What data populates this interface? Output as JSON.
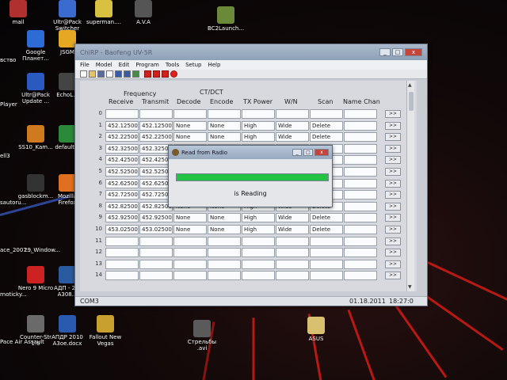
{
  "desktop": {
    "icons": [
      {
        "label": "mail",
        "color": "#b03030"
      },
      {
        "label": "Ultr@Pack Switcher",
        "color": "#3c6bd0"
      },
      {
        "label": "superman....",
        "color": "#d8c040"
      },
      {
        "label": "A.V.A",
        "color": "#555555"
      },
      {
        "label": "BC2Launch...",
        "color": "#6a8a3a"
      },
      {
        "label": "Google Планет...",
        "color": "#2d6bd6"
      },
      {
        "label": "JSGM",
        "color": "#e6a822"
      },
      {
        "label": "Ultr@Pack Update ...",
        "color": "#2a5ac0"
      },
      {
        "label": "EchoL...",
        "color": "#444444"
      },
      {
        "label": "SS10_Kam...",
        "color": "#d07a20"
      },
      {
        "label": "default...",
        "color": "#2a8a3a"
      },
      {
        "label": "gasblockm...",
        "color": "#333333"
      },
      {
        "label": "Mozilla Firefox",
        "color": "#e07020"
      },
      {
        "label": "Nero 9 Micro",
        "color": "#cc2222"
      },
      {
        "label": "АДП - 2... A308...",
        "color": "#2a5aa0"
      },
      {
        "label": "Counter-Str 1.6",
        "color": "#6a6a6a"
      },
      {
        "label": "АПДР 2010 A3oe.docx",
        "color": "#2a5ab0"
      },
      {
        "label": "Fallout New Vegas",
        "color": "#c8a030"
      },
      {
        "label": "Стрельбы .avi",
        "color": "#5a5a5a"
      },
      {
        "label": "ASUS",
        "color": "#d8c070"
      }
    ],
    "left_fragments": [
      "вство",
      "Player",
      "ell3",
      "sautoru...",
      "ace_2007...",
      "rnoticky...",
      "Pace Air Assault",
      "29_Window..."
    ]
  },
  "window": {
    "title": "ChiRP - Baofeng UV-5R",
    "controls": {
      "minimize": "_",
      "maximize": "□",
      "close": "x"
    },
    "menu": [
      "File",
      "Model",
      "Edit",
      "Program",
      "Tools",
      "Setup",
      "Help"
    ],
    "toolbar_icons": [
      "new-icon",
      "open-icon",
      "save-icon",
      "print-icon",
      "save-as-icon",
      "read-icon",
      "write-icon",
      "red-square-icon",
      "grid-icon",
      "grid-icon-2",
      "record-icon"
    ],
    "headers": {
      "group_frequency": "Frequency",
      "group_ctdct": "CT/DCT",
      "columns": [
        "Receive",
        "Transmit",
        "Decode",
        "Encode",
        "TX Power",
        "W/N",
        "Scan",
        "Name Chan"
      ]
    },
    "rows": [
      {
        "num": "0",
        "rx": "",
        "tx": "",
        "dec": "",
        "enc": "",
        "pwr": "",
        "wn": "",
        "scan": "",
        "name": ""
      },
      {
        "num": "1",
        "rx": "452.12500",
        "tx": "452.12500",
        "dec": "None",
        "enc": "None",
        "pwr": "High",
        "wn": "Wide",
        "scan": "Delete",
        "name": ""
      },
      {
        "num": "2",
        "rx": "452.22500",
        "tx": "452.22500",
        "dec": "None",
        "enc": "None",
        "pwr": "High",
        "wn": "Wide",
        "scan": "Delete",
        "name": ""
      },
      {
        "num": "3",
        "rx": "452.32500",
        "tx": "452.32500",
        "dec": "",
        "enc": "",
        "pwr": "",
        "wn": "",
        "scan": "",
        "name": ""
      },
      {
        "num": "4",
        "rx": "452.42500",
        "tx": "452.42500",
        "dec": "",
        "enc": "",
        "pwr": "",
        "wn": "",
        "scan": "",
        "name": ""
      },
      {
        "num": "5",
        "rx": "452.52500",
        "tx": "452.52500",
        "dec": "",
        "enc": "",
        "pwr": "",
        "wn": "",
        "scan": "",
        "name": ""
      },
      {
        "num": "6",
        "rx": "452.62500",
        "tx": "452.62500",
        "dec": "",
        "enc": "",
        "pwr": "",
        "wn": "",
        "scan": "",
        "name": ""
      },
      {
        "num": "7",
        "rx": "452.72500",
        "tx": "452.72500",
        "dec": "",
        "enc": "",
        "pwr": "",
        "wn": "",
        "scan": "",
        "name": ""
      },
      {
        "num": "8",
        "rx": "452.82500",
        "tx": "452.82500",
        "dec": "None",
        "enc": "None",
        "pwr": "High",
        "wn": "Wide",
        "scan": "Delete",
        "name": ""
      },
      {
        "num": "9",
        "rx": "452.92500",
        "tx": "452.92500",
        "dec": "None",
        "enc": "None",
        "pwr": "High",
        "wn": "Wide",
        "scan": "Delete",
        "name": ""
      },
      {
        "num": "10",
        "rx": "453.02500",
        "tx": "453.02500",
        "dec": "None",
        "enc": "None",
        "pwr": "High",
        "wn": "Wide",
        "scan": "Delete",
        "name": ""
      },
      {
        "num": "11",
        "rx": "",
        "tx": "",
        "dec": "",
        "enc": "",
        "pwr": "",
        "wn": "",
        "scan": "",
        "name": ""
      },
      {
        "num": "12",
        "rx": "",
        "tx": "",
        "dec": "",
        "enc": "",
        "pwr": "",
        "wn": "",
        "scan": "",
        "name": ""
      },
      {
        "num": "13",
        "rx": "",
        "tx": "",
        "dec": "",
        "enc": "",
        "pwr": "",
        "wn": "",
        "scan": "",
        "name": ""
      },
      {
        "num": "14",
        "rx": "",
        "tx": "",
        "dec": "",
        "enc": "",
        "pwr": "",
        "wn": "",
        "scan": "",
        "name": ""
      }
    ],
    "row_button_label": ">>",
    "status": {
      "port": "COM3",
      "date": "01.18.2011",
      "time": "18:27:0"
    }
  },
  "dialog": {
    "title": "Read from Radio",
    "progress_label": "",
    "progress_fraction": 1.0,
    "message": "is Reading",
    "controls": {
      "minimize": "_",
      "maximize": "□",
      "close": "x"
    }
  }
}
